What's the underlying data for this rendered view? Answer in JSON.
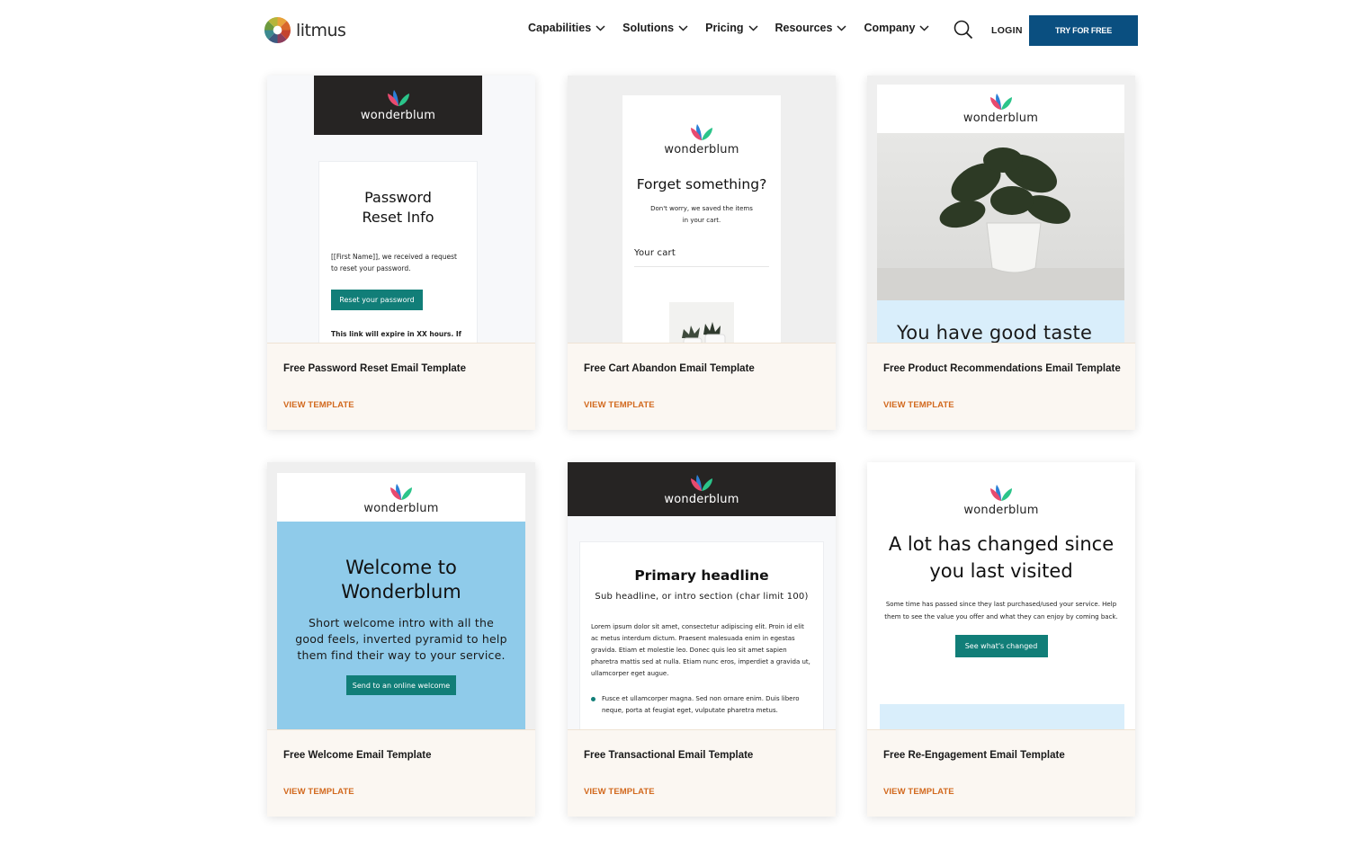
{
  "nav": {
    "brand": "litmus",
    "menu": [
      {
        "label": "Capabilities"
      },
      {
        "label": "Solutions"
      },
      {
        "label": "Pricing"
      },
      {
        "label": "Resources"
      },
      {
        "label": "Company"
      }
    ],
    "login": "LOGIN",
    "cta": "TRY FOR FREE"
  },
  "colors": {
    "brand_blue": "#0a4f80",
    "link_orange": "#d2691e",
    "footer_bg": "#fbf7f2",
    "email_teal": "#117e78",
    "welcome_blue": "#8fcbea"
  },
  "cards": [
    {
      "title": "Free Password Reset Email Template",
      "link": "VIEW TEMPLATE",
      "preview": {
        "brand": "wonderblum",
        "heading_line1": "Password",
        "heading_line2": "Reset Info",
        "body": "[[First Name]], we received a request to reset your password.",
        "button": "Reset your password",
        "footer_text": "This link will expire in XX hours. If"
      }
    },
    {
      "title": "Free Cart Abandon Email Template",
      "link": "VIEW TEMPLATE",
      "preview": {
        "brand": "wonderblum",
        "heading": "Forget something?",
        "body": "Don't worry, we saved the items in your cart.",
        "cart_label": "Your cart"
      }
    },
    {
      "title": "Free Product Recommendations Email Template",
      "link": "VIEW TEMPLATE",
      "preview": {
        "brand": "wonderblum",
        "heading": "You have good taste"
      }
    },
    {
      "title": "Free Welcome Email Template",
      "link": "VIEW TEMPLATE",
      "preview": {
        "brand": "wonderblum",
        "heading_line1": "Welcome to",
        "heading_line2": "Wonderblum",
        "body": "Short welcome intro with all the good feels, inverted pyramid to help them find their way to your service.",
        "button": "Send to an online welcome"
      }
    },
    {
      "title": "Free Transactional Email Template",
      "link": "VIEW TEMPLATE",
      "preview": {
        "brand": "wonderblum",
        "heading": "Primary headline",
        "subheading": "Sub headline, or intro section (char limit 100)",
        "body": "Lorem ipsum dolor sit amet, consectetur adipiscing elit. Proin id elit ac metus interdum dictum. Praesent malesuada enim in egestas gravida. Etiam et molestie leo. Donec quis leo sit amet sapien pharetra mattis sed at nulla. Etiam nunc eros, imperdiet a gravida ut, ullamcorper eget augue.",
        "bullet": "Fusce et ullamcorper magna. Sed non ornare enim. Duis libero neque, porta at feugiat eget, vulputate pharetra metus."
      }
    },
    {
      "title": "Free Re-Engagement Email Template",
      "link": "VIEW TEMPLATE",
      "preview": {
        "brand": "wonderblum",
        "heading_line1": "A lot has changed since",
        "heading_line2": "you last visited",
        "body": "Some time has passed since they last purchased/used your service. Help them to see the value you offer and what they can enjoy by coming back.",
        "button": "See what's changed"
      }
    }
  ]
}
